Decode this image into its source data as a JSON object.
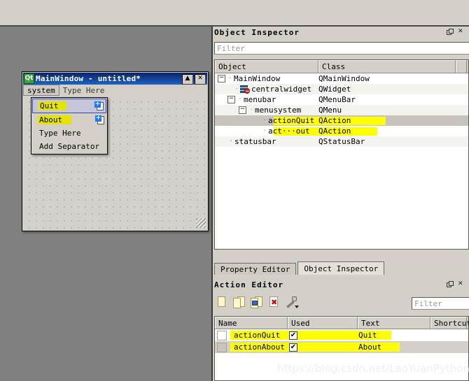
{
  "form": {
    "logo": "Qt",
    "title": "MainWindow - untitled*",
    "buttons": {
      "maximize": "▲",
      "close": "✕"
    },
    "menubar": [
      {
        "label": "system",
        "state": "selected"
      },
      {
        "label": "Type Here",
        "state": "placeholder"
      }
    ],
    "popup": [
      {
        "label": "Quit",
        "highlighted": true,
        "selected": true,
        "icon": "add-action-icon"
      },
      {
        "label": "About",
        "highlighted": true,
        "selected": false,
        "icon": "add-action-icon"
      },
      {
        "label": "Type Here",
        "highlighted": false,
        "selected": false,
        "icon": ""
      },
      {
        "label": "Add Separator",
        "highlighted": false,
        "selected": false,
        "icon": ""
      }
    ]
  },
  "object_inspector": {
    "title": "Object Inspector",
    "filter_placeholder": "Filter",
    "filter_value": "",
    "columns": [
      "Object",
      "Class"
    ],
    "rows": [
      {
        "object": "MainWindow",
        "class": "QMainWindow",
        "indent": 0,
        "expander": "−",
        "icon": "",
        "highlight": false,
        "selected": false
      },
      {
        "object": "centralwidget",
        "class": "QWidget",
        "indent": 1,
        "expander": "",
        "icon": "widget-disabled-icon",
        "highlight": false,
        "selected": false
      },
      {
        "object": "menubar",
        "class": "QMenuBar",
        "indent": 1,
        "expander": "−",
        "icon": "",
        "highlight": false,
        "selected": false
      },
      {
        "object": "menusystem",
        "class": "QMenu",
        "indent": 2,
        "expander": "−",
        "icon": "",
        "highlight": false,
        "selected": false
      },
      {
        "object": "actionQuit",
        "class": "QAction",
        "indent": 3,
        "expander": "",
        "icon": "",
        "highlight": true,
        "selected": true
      },
      {
        "object": "act···out",
        "class": "QAction",
        "indent": 3,
        "expander": "",
        "icon": "",
        "highlight": true,
        "selected": false
      },
      {
        "object": "statusbar",
        "class": "QStatusBar",
        "indent": 1,
        "expander": "",
        "icon": "",
        "highlight": false,
        "selected": false
      }
    ]
  },
  "tabs": [
    {
      "label": "Property Editor",
      "active": false
    },
    {
      "label": "Object Inspector",
      "active": true
    }
  ],
  "action_editor": {
    "title": "Action Editor",
    "filter_placeholder": "Filter",
    "filter_value": "",
    "toolbar": [
      "new-action-icon",
      "copy-action-icon",
      "paste-action-icon",
      "delete-action-icon",
      "configure-icon"
    ],
    "columns": [
      "Name",
      "Used",
      "Text",
      "Shortcut"
    ],
    "rows": [
      {
        "name": "actionQuit",
        "used": "✔",
        "text": "Quit",
        "shortcut": "",
        "highlight": true
      },
      {
        "name": "actionAbout",
        "used": "✔",
        "text": "About",
        "shortcut": "",
        "highlight": true
      }
    ]
  },
  "watermark": "https://blog.csdn.net/LaoYuanPython",
  "colors": {
    "highlight_yellow": "#ffff00",
    "titlebar_blue": "#15489c",
    "panel_gray": "#d4d0c8",
    "workspace_gray": "#808080"
  }
}
